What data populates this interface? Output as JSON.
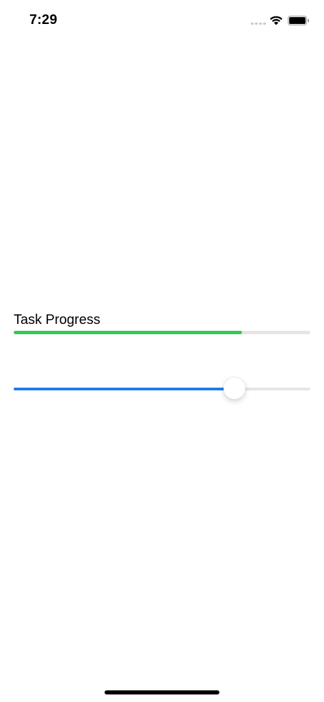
{
  "status_bar": {
    "time": "7:29",
    "icons": [
      "cellular-signal-icon",
      "wifi-icon",
      "battery-icon"
    ]
  },
  "task": {
    "label": "Task Progress",
    "progress": 0.77,
    "progress_color": "#34c759",
    "track_color": "#e5e5e6"
  },
  "slider": {
    "value": 0.745,
    "fill_color": "#1b7bec",
    "track_color": "#e5e5e6"
  }
}
